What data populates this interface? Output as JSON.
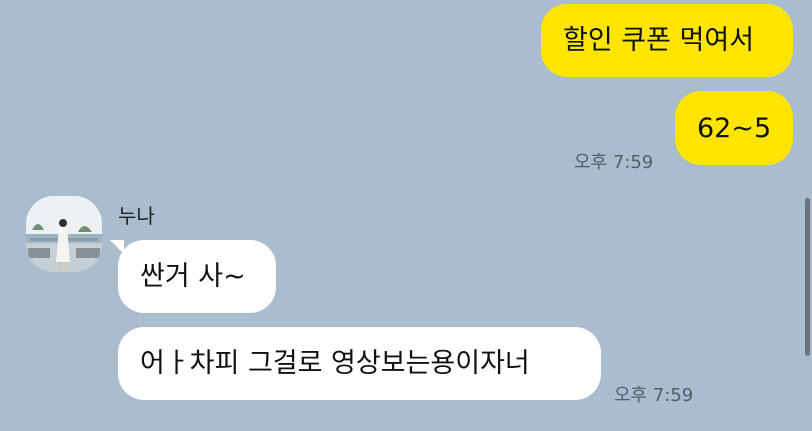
{
  "messages": [
    {
      "direction": "out",
      "text": "할인 쿠폰 먹여서"
    },
    {
      "direction": "out",
      "text": "62~5",
      "time": "오후 7:59"
    },
    {
      "direction": "in",
      "sender": "누나",
      "text": "싼거 사~"
    },
    {
      "direction": "in",
      "text": "어ㅏ차피 그걸로 영상보는용이자너",
      "time": "오후 7:59"
    }
  ],
  "colors": {
    "background": "#a9bdce",
    "outgoing_bubble": "#fee500",
    "incoming_bubble": "#ffffff"
  },
  "icons": {
    "avatar": "profile-photo"
  }
}
